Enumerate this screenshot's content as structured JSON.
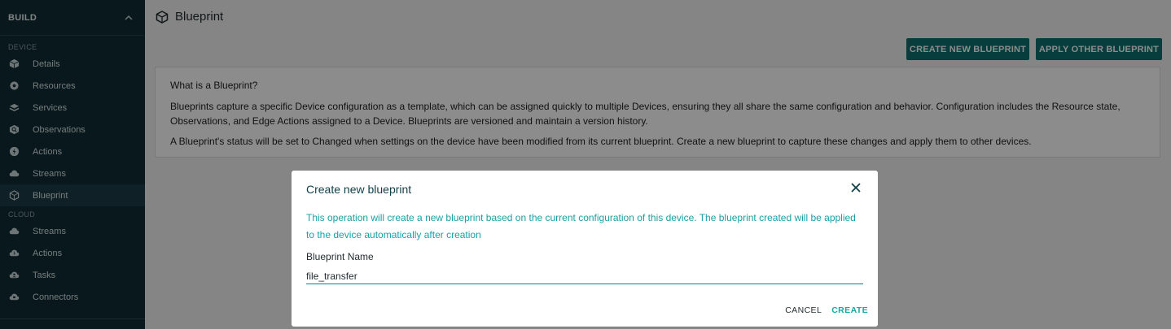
{
  "sidebar": {
    "build_title": "BUILD",
    "device_label": "DEVICE",
    "device_items": [
      {
        "label": "Details",
        "icon": "cube-icon"
      },
      {
        "label": "Resources",
        "icon": "gear-icon"
      },
      {
        "label": "Services",
        "icon": "layers-icon"
      },
      {
        "label": "Observations",
        "icon": "magnifier-icon"
      },
      {
        "label": "Actions",
        "icon": "bolt-icon"
      },
      {
        "label": "Streams",
        "icon": "cloud-icon"
      },
      {
        "label": "Blueprint",
        "icon": "hexagon-icon"
      }
    ],
    "cloud_label": "CLOUD",
    "cloud_items": [
      {
        "label": "Streams",
        "icon": "cloud-icon"
      },
      {
        "label": "Actions",
        "icon": "cloud-bolt-icon"
      },
      {
        "label": "Tasks",
        "icon": "cloud-person-icon"
      },
      {
        "label": "Connectors",
        "icon": "cloud-plug-icon"
      }
    ]
  },
  "header": {
    "title": "Blueprint"
  },
  "toolbar": {
    "create_label": "CREATE NEW BLUEPRINT",
    "apply_label": "APPLY OTHER BLUEPRINT"
  },
  "info": {
    "heading": "What is a Blueprint?",
    "para1": "Blueprints capture a specific Device configuration as a template, which can be assigned quickly to multiple Devices, ensuring they all share the same configuration and behavior. Configuration includes the Resource state, Observations, and Edge Actions assigned to a Device. Blueprints are versioned and maintain a version history.",
    "para2": "A Blueprint's status will be set to Changed when settings on the device have been modified from its current blueprint. Create a new blueprint to capture these changes and apply them to other devices."
  },
  "dialog": {
    "title": "Create new blueprint",
    "description": "This operation will create a new blueprint based on the current configuration of this device. The blueprint created will be applied to the device automatically after creation",
    "field_label": "Blueprint Name",
    "field_value": "file_transfer",
    "cancel_label": "CANCEL",
    "create_label": "CREATE"
  },
  "colors": {
    "sidebar_bg": "#0f2d35",
    "accent": "#0e6f6f",
    "desc_text": "#17a2a2"
  }
}
